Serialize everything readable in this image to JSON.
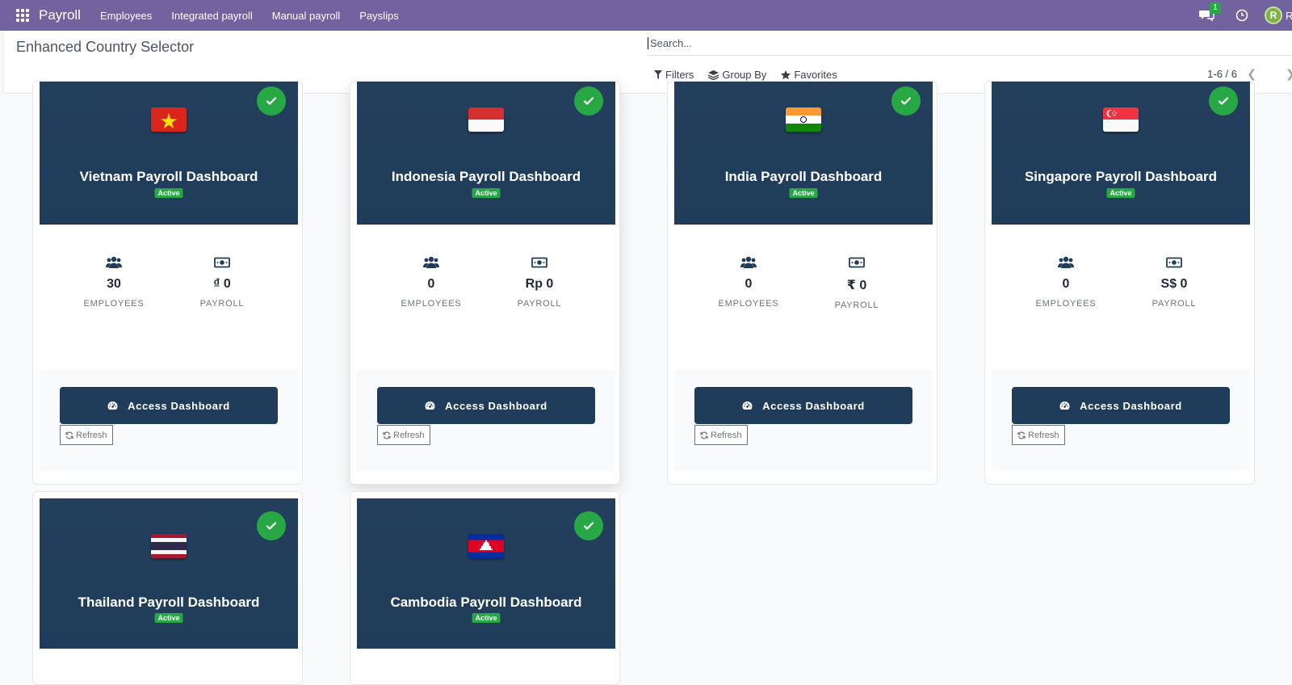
{
  "topbar": {
    "app_name": "Payroll",
    "menu": [
      "Employees",
      "Integrated payroll",
      "Manual payroll",
      "Payslips"
    ],
    "chat_count": "1",
    "avatar_initial": "R",
    "avatar_trail": "R"
  },
  "control": {
    "breadcrumb": "Enhanced Country Selector",
    "search_placeholder": "Search...",
    "filters_label": "Filters",
    "groupby_label": "Group By",
    "favorites_label": "Favorites",
    "pager": "1-6 / 6"
  },
  "labels": {
    "employees": "EMPLOYEES",
    "payroll": "PAYROLL",
    "access": "Access Dashboard",
    "refresh": "Refresh",
    "active": "Active"
  },
  "cards": [
    {
      "title": "Vietnam Payroll Dashboard",
      "flag": "vietnam-flag",
      "employees": "30",
      "payroll": "₫ 0"
    },
    {
      "title": "Indonesia Payroll Dashboard",
      "flag": "indonesia-flag",
      "employees": "0",
      "payroll": "Rp 0"
    },
    {
      "title": "India Payroll Dashboard",
      "flag": "india-flag",
      "employees": "0",
      "payroll": "₹ 0"
    },
    {
      "title": "Singapore Payroll Dashboard",
      "flag": "singapore-flag",
      "employees": "0",
      "payroll": "S$ 0"
    },
    {
      "title": "Thailand Payroll Dashboard",
      "flag": "thailand-flag",
      "employees": "",
      "payroll": ""
    },
    {
      "title": "Cambodia Payroll Dashboard",
      "flag": "cambodia-flag",
      "employees": "",
      "payroll": ""
    }
  ],
  "colors": {
    "topbar": "#71639e",
    "card_header": "#1f3d5a",
    "success": "#28a745"
  }
}
